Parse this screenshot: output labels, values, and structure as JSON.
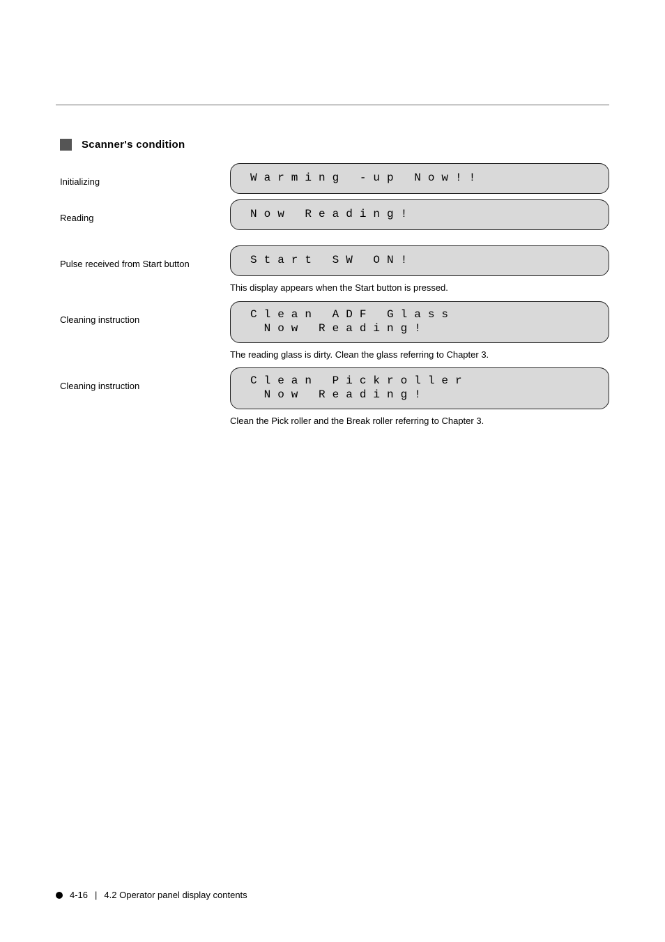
{
  "group": {
    "title": "Scanner's condition"
  },
  "labels": {
    "initializing": "Initializing",
    "reading": "Reading",
    "start_pulse": "Pulse received from Start button",
    "clean_glass": "Cleaning instruction",
    "clean_roller": "Cleaning instruction"
  },
  "descriptions": {
    "start_pulse": "This display appears when the Start button is pressed.",
    "clean_glass": "The reading glass is dirty. Clean the glass referring to Chapter 3.",
    "clean_roller": "Clean the Pick roller and the Break roller referring to Chapter 3."
  },
  "lcd": {
    "warming": "Warming -up Now!!",
    "reading": "Now Reading!",
    "start_sw": "Start SW ON!",
    "clean_glass_l1": "Clean ADF Glass",
    "clean_glass_l2": " Now Reading!",
    "clean_roller_l1": "Clean Pickroller",
    "clean_roller_l2": " Now Reading!"
  },
  "footer": {
    "page": "4-16",
    "title": "4.2 Operator panel display contents"
  }
}
